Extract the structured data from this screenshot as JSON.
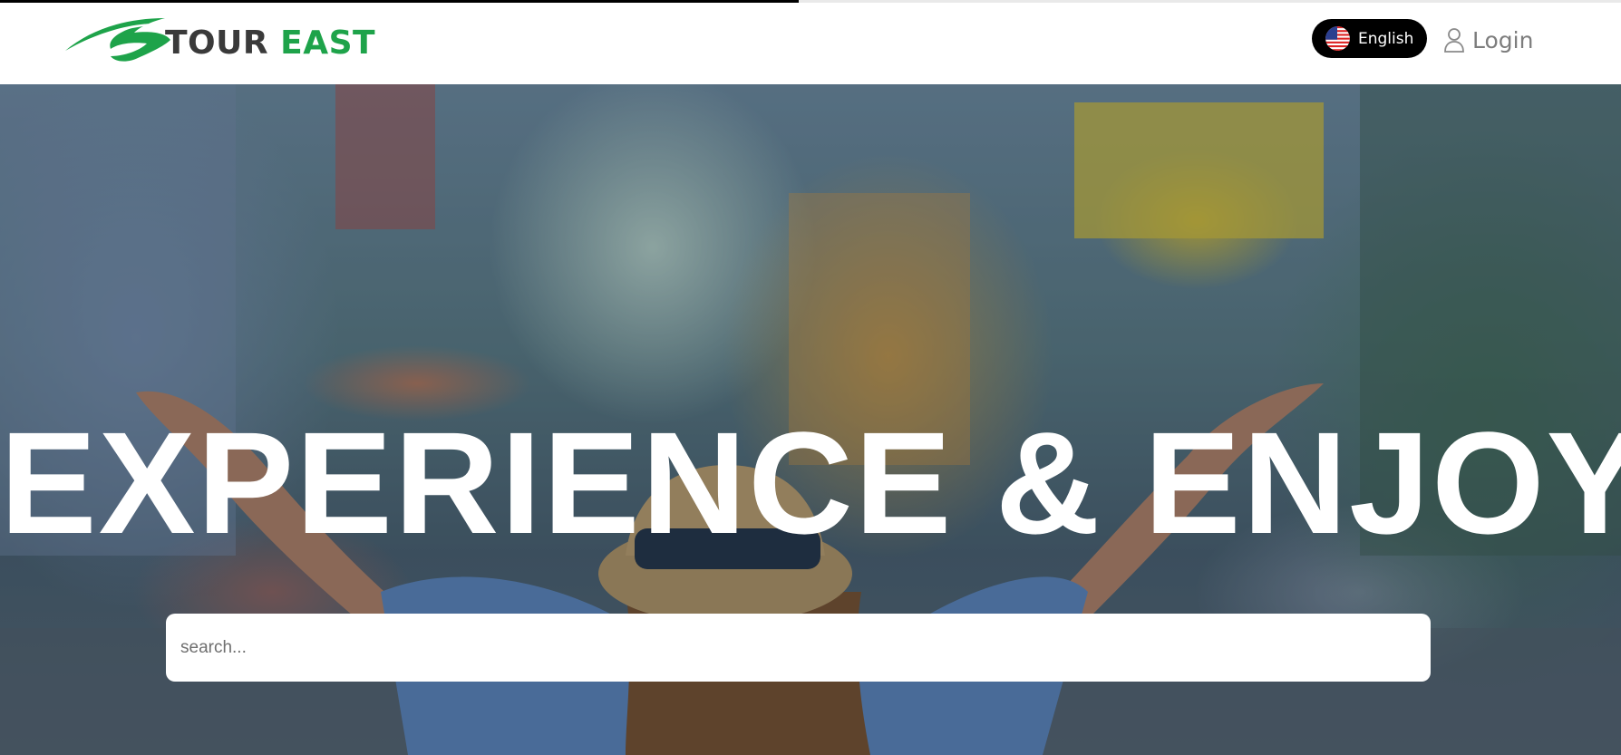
{
  "page_loading": {
    "progress_percent": 49.3
  },
  "header": {
    "logo": {
      "text_primary": "TOUR",
      "text_accent": "EAST",
      "brand_color": "#1ea34a",
      "text_color": "#3a3a3a"
    },
    "language": {
      "label": "English",
      "flag_icon": "us-flag-icon"
    },
    "login": {
      "label": "Login",
      "icon": "user-icon"
    }
  },
  "hero": {
    "title": "EXPERIENCE & ENJOY",
    "search": {
      "placeholder": "search...",
      "value": ""
    }
  }
}
